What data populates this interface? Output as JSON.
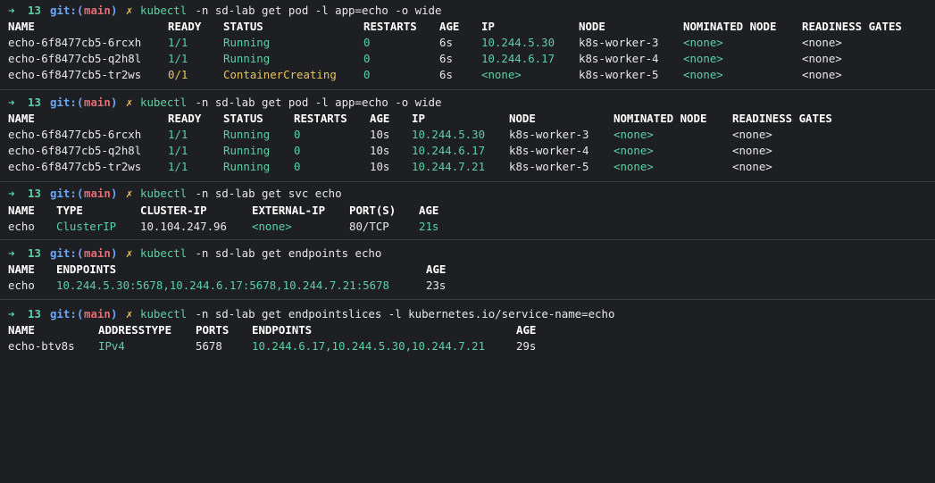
{
  "prompt": {
    "arrow": "➜",
    "count": "13",
    "git": "git:",
    "branch_open": "(",
    "branch": "main",
    "branch_close": ")",
    "dirty": "✗"
  },
  "blocks": [
    {
      "cmd_kw": "kubectl",
      "cmd_rest": " -n sd-lab get pod -l app=echo -o wide",
      "headers": [
        "NAME",
        "READY",
        "STATUS",
        "RESTARTS",
        "AGE",
        "IP",
        "NODE",
        "NOMINATED NODE",
        "READINESS GATES"
      ],
      "rows": [
        [
          "echo-6f8477cb5-6rcxh",
          "1/1",
          "Running",
          "0",
          "6s",
          "10.244.5.30",
          "k8s-worker-3",
          "<none>",
          "<none>"
        ],
        [
          "echo-6f8477cb5-q2h8l",
          "1/1",
          "Running",
          "0",
          "6s",
          "10.244.6.17",
          "k8s-worker-4",
          "<none>",
          "<none>"
        ],
        [
          "echo-6f8477cb5-tr2ws",
          "0/1",
          "ContainerCreating",
          "0",
          "6s",
          "<none>",
          "k8s-worker-5",
          "<none>",
          "<none>"
        ]
      ]
    },
    {
      "cmd_kw": "kubectl",
      "cmd_rest": " -n sd-lab get pod -l app=echo -o wide",
      "headers": [
        "NAME",
        "READY",
        "STATUS",
        "RESTARTS",
        "AGE",
        "IP",
        "NODE",
        "NOMINATED NODE",
        "READINESS GATES"
      ],
      "rows": [
        [
          "echo-6f8477cb5-6rcxh",
          "1/1",
          "Running",
          "0",
          "10s",
          "10.244.5.30",
          "k8s-worker-3",
          "<none>",
          "<none>"
        ],
        [
          "echo-6f8477cb5-q2h8l",
          "1/1",
          "Running",
          "0",
          "10s",
          "10.244.6.17",
          "k8s-worker-4",
          "<none>",
          "<none>"
        ],
        [
          "echo-6f8477cb5-tr2ws",
          "1/1",
          "Running",
          "0",
          "10s",
          "10.244.7.21",
          "k8s-worker-5",
          "<none>",
          "<none>"
        ]
      ]
    },
    {
      "cmd_kw": "kubectl",
      "cmd_rest": " -n sd-lab get svc echo",
      "headers": [
        "NAME",
        "TYPE",
        "CLUSTER-IP",
        "EXTERNAL-IP",
        "PORT(S)",
        "AGE"
      ],
      "rows": [
        [
          "echo",
          "ClusterIP",
          "10.104.247.96",
          "<none>",
          "80/TCP",
          "21s"
        ]
      ]
    },
    {
      "cmd_kw": "kubectl",
      "cmd_rest": " -n sd-lab get endpoints echo",
      "headers": [
        "NAME",
        "ENDPOINTS",
        "AGE"
      ],
      "rows": [
        [
          "echo",
          "10.244.5.30:5678,10.244.6.17:5678,10.244.7.21:5678",
          "23s"
        ]
      ]
    },
    {
      "cmd_kw": "kubectl",
      "cmd_rest": " -n sd-lab get endpointslices -l kubernetes.io/service-name=echo",
      "headers": [
        "NAME",
        "ADDRESSTYPE",
        "PORTS",
        "ENDPOINTS",
        "AGE"
      ],
      "rows": [
        [
          "echo-btv8s",
          "IPv4",
          "5678",
          "10.244.6.17,10.244.5.30,10.244.7.21",
          "29s"
        ]
      ]
    }
  ],
  "colors": {
    "background": "#1e1f22",
    "accent_green": "#5ad1a5",
    "accent_yellow": "#e6c35c",
    "git_blue": "#6aa7ff",
    "branch_red": "#e06c75"
  }
}
